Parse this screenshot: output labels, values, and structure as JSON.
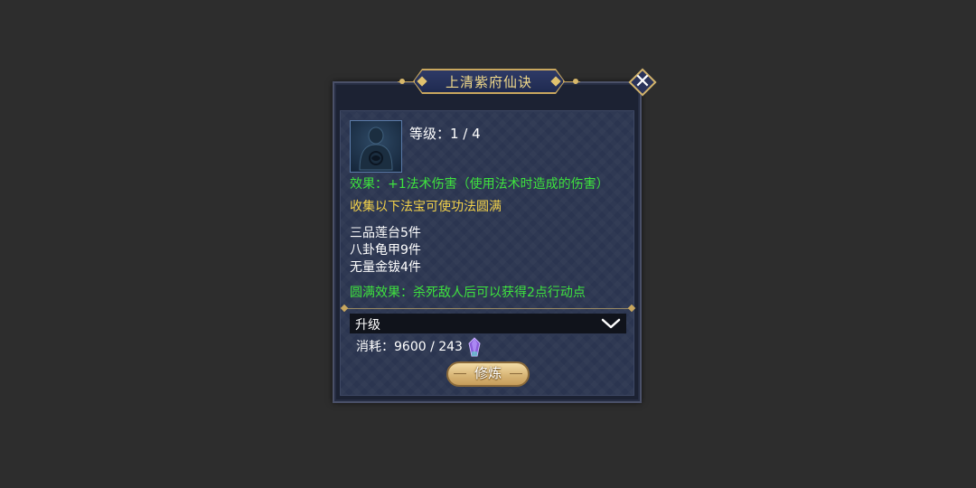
{
  "window": {
    "title": "上清紫府仙诀",
    "close_icon": "close-icon"
  },
  "skill": {
    "icon": "meditating-figure-icon",
    "level_label": "等级：1 / 4",
    "effect": "效果：+1法术伤害（使用法术时造成的伤害）",
    "collect_hint": "收集以下法宝可使功法圆满",
    "treasures": [
      "三品莲台5件",
      "八卦龟甲9件",
      "无量金钹4件"
    ],
    "complete_effect": "圆满效果：杀死敌人后可以获得2点行动点"
  },
  "upgrade": {
    "dropdown_label": "升级",
    "chevron_icon": "chevron-down-icon",
    "cost_label": "消耗：9600 / 243",
    "cost_icon": "crystal-gem-icon",
    "practice_button": "修炼"
  },
  "colors": {
    "effect_text": "#3ee33e",
    "hint_text": "#f3d24a",
    "title_text": "#f0d98a",
    "accent_gold": "#c9a75e"
  }
}
